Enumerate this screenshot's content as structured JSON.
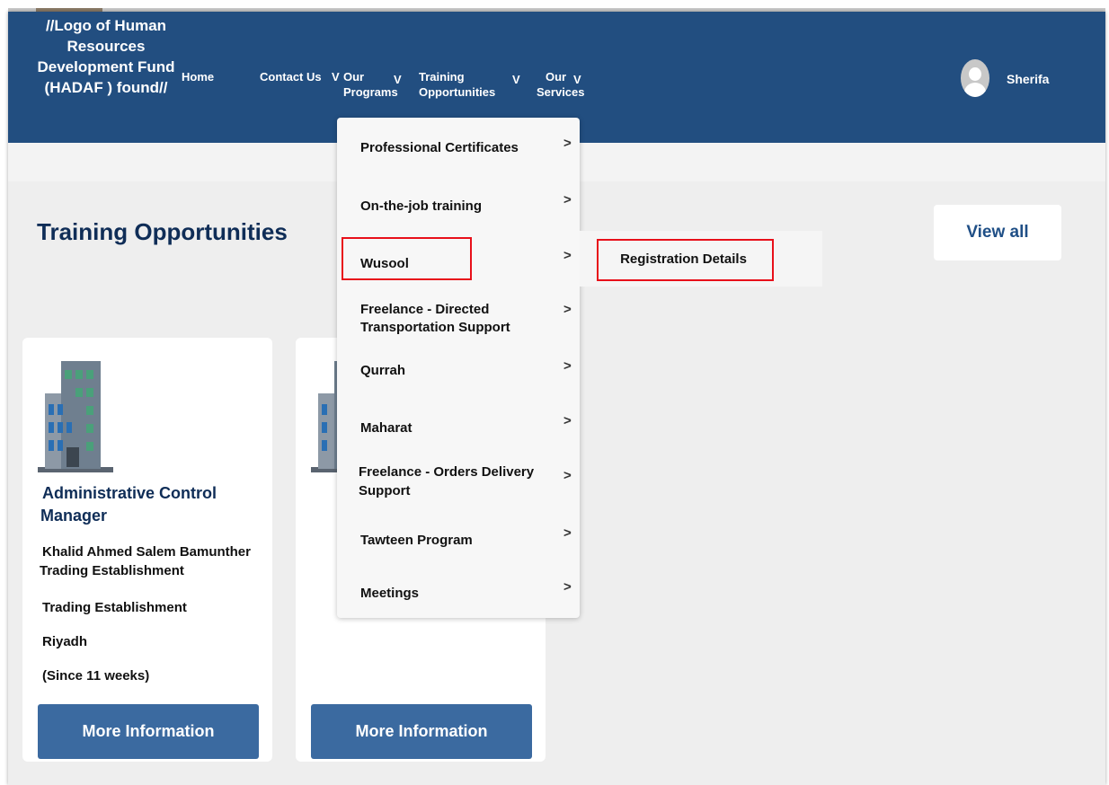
{
  "header": {
    "logo_placeholder": "//Logo of Human Resources Development Fund (HADAF ) found//",
    "user_name": "Sherifa",
    "bg_color": "#224e80"
  },
  "nav": {
    "home": "Home",
    "contact": "Contact Us",
    "programs_1": "Our",
    "programs_2": "Programs",
    "training_1": "Training",
    "training_2": "Opportunities",
    "services_1": "Our",
    "services_2": "Services",
    "chevron": "V"
  },
  "main": {
    "section_title": "Training Opportunities",
    "view_all": "View all"
  },
  "cards": [
    {
      "role_1": "Administrative Control",
      "role_2": "Manager",
      "company_1": "Khalid Ahmed Salem Bamunther",
      "company_2": "Trading Establishment",
      "type": "Trading Establishment",
      "city": "Riyadh",
      "since": "(Since 11 weeks)",
      "button": "More Information"
    },
    {
      "button": "More Information"
    }
  ],
  "dropdown": {
    "arrow": ">",
    "items": [
      {
        "label_1": "Professional Certificates"
      },
      {
        "label_1": "On-the-job training"
      },
      {
        "label_1": "Wusool"
      },
      {
        "label_1": "Freelance - Directed",
        "label_2": "Transportation Support"
      },
      {
        "label_1": "Qurrah"
      },
      {
        "label_1": "Maharat"
      },
      {
        "label_1": "Freelance - Orders Delivery",
        "label_2": "Support"
      },
      {
        "label_1": "Tawteen Program"
      },
      {
        "label_1": "Meetings"
      }
    ]
  },
  "submenu": {
    "item": "Registration Details"
  },
  "colors": {
    "accent": "#224e80",
    "button": "#3b6aa0",
    "highlight": "#e8101a",
    "title": "#0f2d57"
  }
}
